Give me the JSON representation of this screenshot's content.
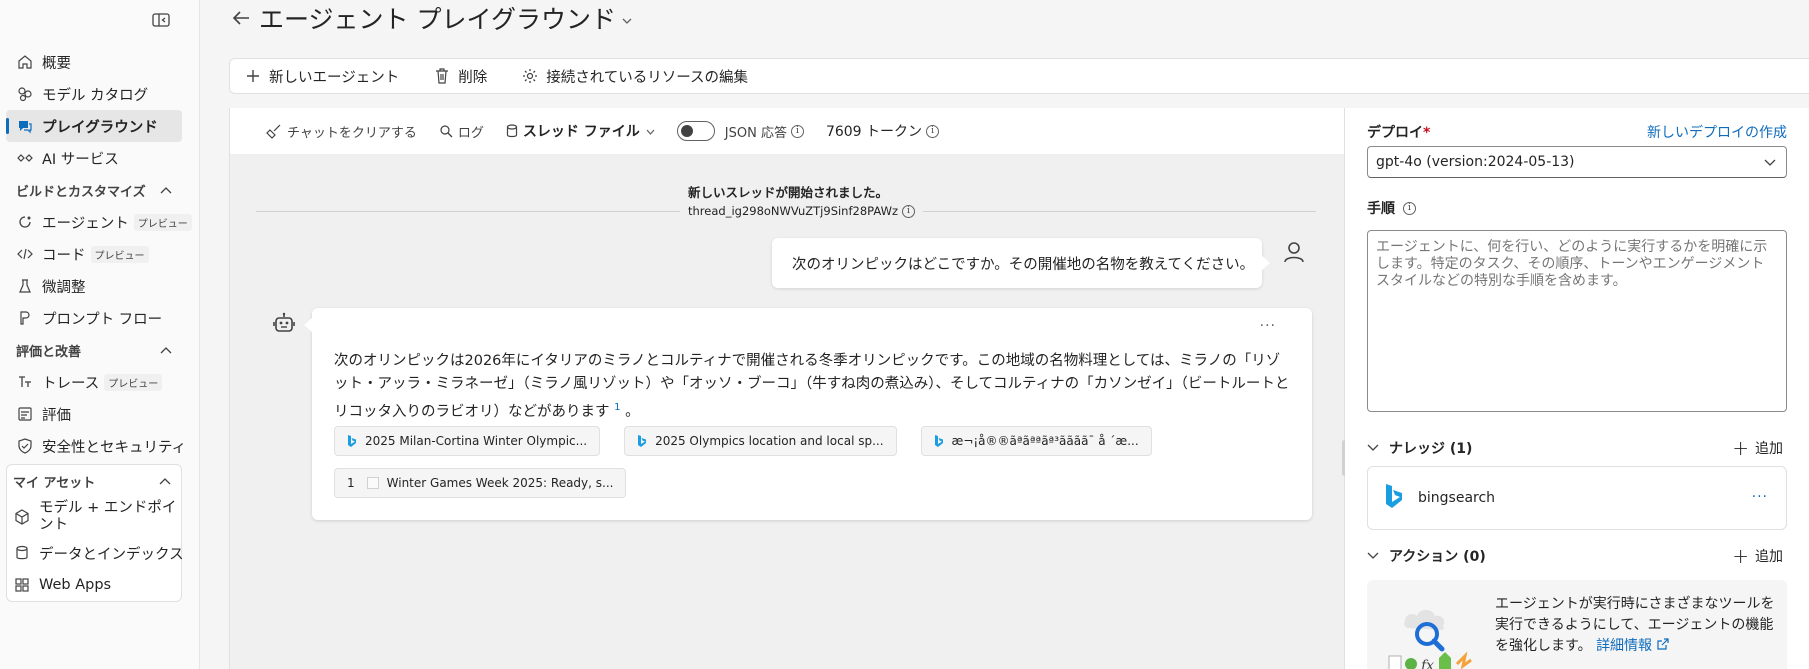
{
  "sidebar": {
    "items": [
      {
        "label": "概要",
        "icon": "home-icon"
      },
      {
        "label": "モデル カタログ",
        "icon": "catalog-icon"
      },
      {
        "label": "プレイグラウンド",
        "icon": "chat-icon",
        "active": true
      },
      {
        "label": "AI サービス",
        "icon": "ai-services-icon"
      }
    ],
    "build_section": {
      "title": "ビルドとカスタマイズ",
      "items": [
        {
          "label": "エージェント",
          "badge": "プレビュー"
        },
        {
          "label": "コード",
          "badge": "プレビュー"
        },
        {
          "label": "微調整"
        },
        {
          "label": "プロンプト フロー"
        }
      ]
    },
    "eval_section": {
      "title": "評価と改善",
      "items": [
        {
          "label": "トレース",
          "badge": "プレビュー"
        },
        {
          "label": "評価"
        },
        {
          "label": "安全性とセキュリティ"
        }
      ]
    },
    "assets_section": {
      "title": "マイ アセット",
      "items": [
        {
          "label": "モデル + エンドポイント"
        },
        {
          "label": "データとインデックス"
        },
        {
          "label": "Web Apps"
        }
      ]
    }
  },
  "header": {
    "title": "エージェント プレイグラウンド"
  },
  "toolbar": {
    "new_agent": "新しいエージェント",
    "delete": "削除",
    "edit_resources": "接続されているリソースの編集"
  },
  "chat_toolbar": {
    "clear_chat": "チャットをクリアする",
    "log": "ログ",
    "thread_files": "スレッド ファイル",
    "json_response": "JSON 応答",
    "tokens": "7609 トークン"
  },
  "thread": {
    "started": "新しいスレッドが開始されました。",
    "id": "thread_ig298oNWVuZTj9Sinf28PAWz"
  },
  "messages": {
    "user": "次のオリンピックはどこですか。その開催地の名物を教えてください。",
    "assistant": "次のオリンピックは2026年にイタリアのミラノとコルティナで開催される冬季オリンピックです。この地域の名物料理としては、ミラノの「リゾット・アッラ・ミラネーゼ」（ミラノ風リゾット）や「オッソ・ブーコ」（牛すね肉の煮込み）、そしてコルティナの「カソンゼイ」（ビートルートとリコッタ入りのラビオリ）などがあります",
    "assistant_sup": "1",
    "assistant_end": "。",
    "more": "···",
    "citations": [
      "2025 Milan-Cortina Winter Olympic...",
      "2025 Olympics location and local sp...",
      "æ¬¡å®®ãªãªªãª³ãããã¯ å ´æ..."
    ],
    "extra_citation": {
      "num": "1",
      "label": "Winter Games Week 2025: Ready, s..."
    }
  },
  "right_panel": {
    "deploy_label": "デプロイ",
    "required_mark": "*",
    "new_deploy_link": "新しいデプロイの作成",
    "deployment_value": "gpt-4o (version:2024-05-13)",
    "instructions_label": "手順",
    "instructions_placeholder": "エージェントに、何を行い、どのように実行するかを明確に示します。特定のタスク、その順序、トーンやエンゲージメント スタイルなどの特別な手順を含めます。",
    "knowledge_label": "ナレッジ (1)",
    "add_label": "追加",
    "knowledge_item": "bingsearch",
    "actions_label": "アクション (0)",
    "actions_desc": "エージェントが実行時にさまざまなツールを実行できるようにして、エージェントの機能を強化します。",
    "details_link": "詳細情報"
  },
  "colors": {
    "accent": "#0f6cbd",
    "required": "#c50f1f",
    "bing_blue": "#1b9de2"
  }
}
